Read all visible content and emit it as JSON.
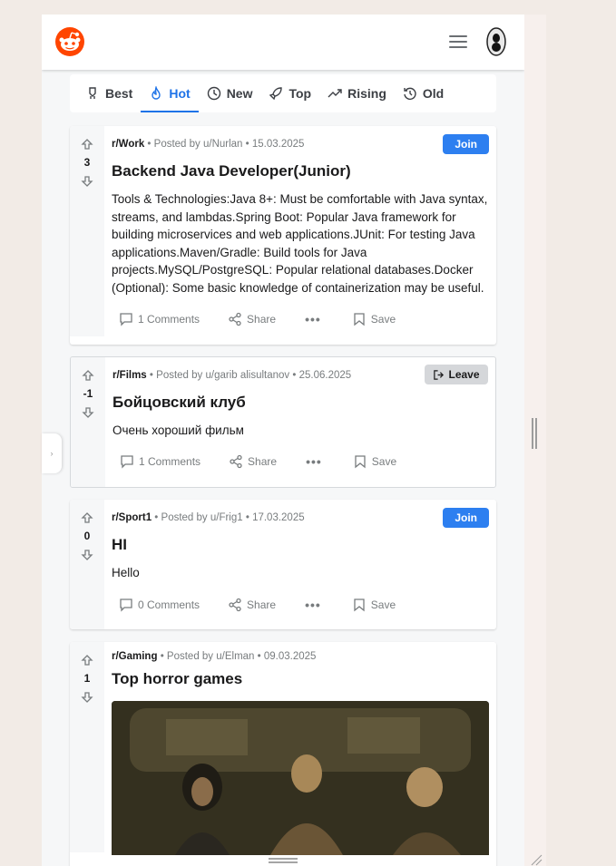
{
  "tabs": [
    {
      "label": "Best",
      "icon": "rocket-icon"
    },
    {
      "label": "Hot",
      "icon": "flame-icon"
    },
    {
      "label": "New",
      "icon": "clock-icon"
    },
    {
      "label": "Top",
      "icon": "rocket-icon"
    },
    {
      "label": "Rising",
      "icon": "trending-up-icon"
    },
    {
      "label": "Old",
      "icon": "history-icon"
    }
  ],
  "active_tab": "Hot",
  "colors": {
    "accent": "#1e73e8",
    "join": "#2d7ff0",
    "logo": "#ff4500"
  },
  "posts": [
    {
      "subreddit": "r/Work",
      "posted_by": "• Posted by u/Nurlan • 15.03.2025",
      "score": "3",
      "title": "Backend Java Developer(Junior)",
      "body": "Tools & Technologies:Java 8+: Must be comfortable with Java syntax, streams, and lambdas.Spring Boot: Popular Java framework for building microservices and web applications.JUnit: For testing Java applications.Maven/Gradle: Build tools for Java projects.MySQL/PostgreSQL: Popular relational databases.Docker (Optional): Some basic knowledge of containerization may be useful.",
      "button": "Join",
      "comments": "1 Comments",
      "share": "Share",
      "save": "Save"
    },
    {
      "subreddit": "r/Films",
      "posted_by": "• Posted by u/garib alisultanov • 25.06.2025",
      "score": "-1",
      "title": "Бойцовский клуб",
      "body": "Очень хороший фильм",
      "button": "Leave",
      "comments": "1 Comments",
      "share": "Share",
      "save": "Save"
    },
    {
      "subreddit": "r/Sport1",
      "posted_by": "• Posted by u/Frig1 • 17.03.2025",
      "score": "0",
      "title": "HI",
      "body": "Hello",
      "button": "Join",
      "comments": "0 Comments",
      "share": "Share",
      "save": "Save"
    },
    {
      "subreddit": "r/Gaming",
      "posted_by": "• Posted by u/Elman • 09.03.2025",
      "score": "1",
      "title": "Top horror games"
    }
  ]
}
